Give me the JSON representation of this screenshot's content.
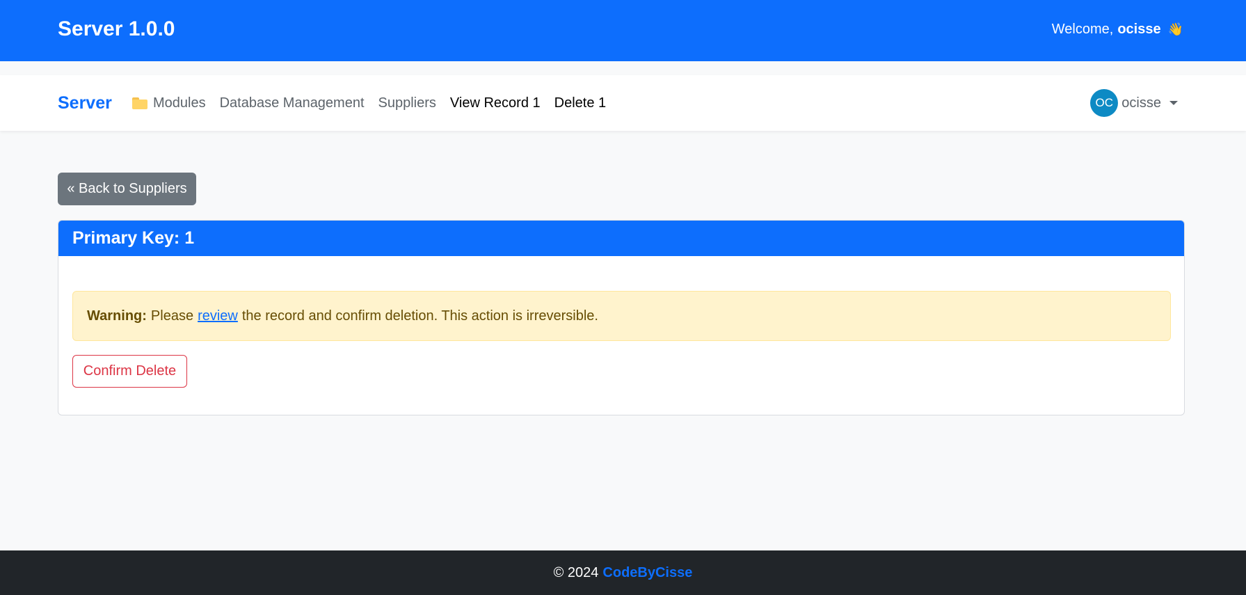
{
  "header": {
    "title": "Server 1.0.0",
    "welcome_prefix": "Welcome,",
    "username": "ocisse",
    "wave_emoji": "👋"
  },
  "navbar": {
    "brand": "Server",
    "items": [
      {
        "label": "Modules",
        "icon": "folder-icon"
      },
      {
        "label": "Database Management"
      },
      {
        "label": "Suppliers"
      },
      {
        "label": "View Record 1"
      },
      {
        "label": "Delete 1"
      }
    ],
    "user": {
      "initials": "OC",
      "name": "ocisse"
    }
  },
  "main": {
    "back_button": "« Back to Suppliers",
    "card": {
      "title": "Primary Key: 1",
      "alert": {
        "label": "Warning:",
        "before": "Please",
        "link": "review",
        "after": "the record and confirm deletion. This action is irreversible."
      },
      "confirm_button": "Confirm Delete"
    }
  },
  "footer": {
    "copyright": "© 2024",
    "brand": "CodeByCisse"
  },
  "colors": {
    "primary": "#0d6efd",
    "secondary": "#6c757d",
    "danger": "#dc3545",
    "warning_bg": "#fff3cd",
    "footer_bg": "#212529"
  }
}
